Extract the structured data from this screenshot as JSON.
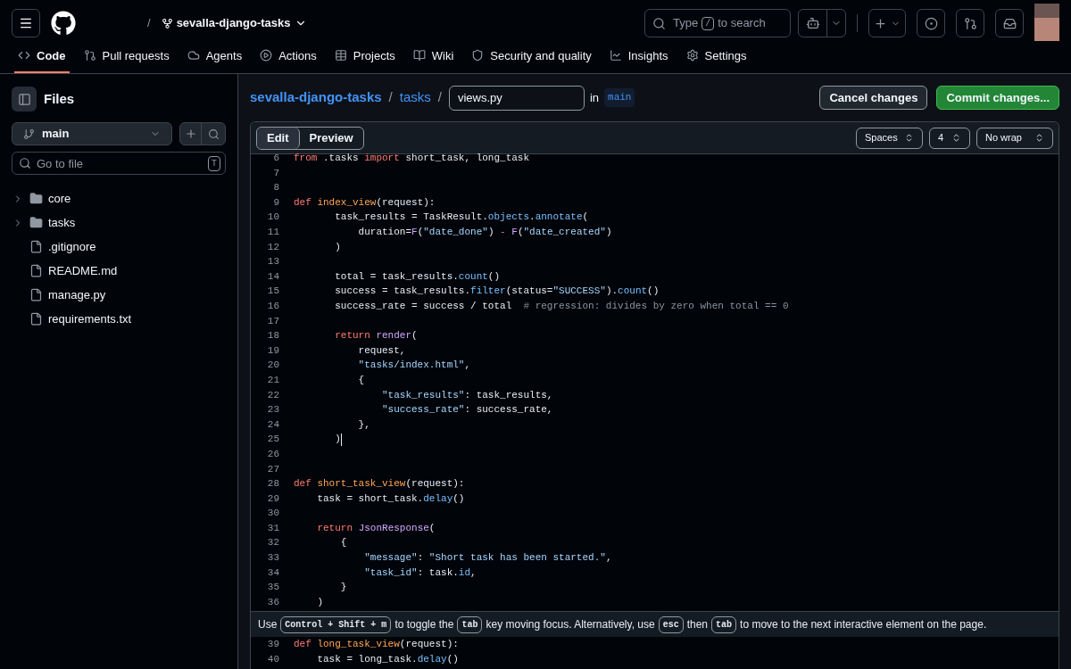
{
  "header": {
    "repo": "sevalla-django-tasks",
    "separator": "/",
    "search": {
      "placeholder_before": "Type",
      "key": "/",
      "placeholder_after": "to search"
    }
  },
  "nav": [
    {
      "label": "Code",
      "selected": true
    },
    {
      "label": "Pull requests",
      "selected": false
    },
    {
      "label": "Agents",
      "selected": false
    },
    {
      "label": "Actions",
      "selected": false
    },
    {
      "label": "Projects",
      "selected": false
    },
    {
      "label": "Wiki",
      "selected": false
    },
    {
      "label": "Security and quality",
      "selected": false
    },
    {
      "label": "Insights",
      "selected": false
    },
    {
      "label": "Settings",
      "selected": false
    }
  ],
  "sidebar": {
    "title": "Files",
    "branch": "main",
    "search": {
      "placeholder": "Go to file",
      "key": "T"
    },
    "items": [
      {
        "kind": "folder",
        "name": "core",
        "expanded": false
      },
      {
        "kind": "folder",
        "name": "tasks",
        "expanded": false
      },
      {
        "kind": "file",
        "name": ".gitignore"
      },
      {
        "kind": "file",
        "name": "README.md"
      },
      {
        "kind": "file",
        "name": "manage.py"
      },
      {
        "kind": "file",
        "name": "requirements.txt"
      }
    ]
  },
  "breadcrumb": {
    "repo": "sevalla-django-tasks",
    "folder": "tasks",
    "separator": "/",
    "filename": "views.py",
    "in_label": "in",
    "branch": "main"
  },
  "actions": [
    "Cancel changes",
    "Commit changes..."
  ],
  "editor": {
    "tabs": [
      {
        "label": "Edit",
        "selected": true
      },
      {
        "label": "Preview",
        "selected": false
      }
    ],
    "selects": [
      "Spaces",
      "4",
      "No wrap"
    ],
    "lines": [
      {
        "number": "6",
        "tokens": [
          {
            "kind": "keyword",
            "text": "from"
          },
          {
            "kind": "plain",
            "text": " .tasks "
          },
          {
            "kind": "keyword",
            "text": "import"
          },
          {
            "kind": "plain",
            "text": " short_task, long_task"
          }
        ]
      },
      {
        "number": "7"
      },
      {
        "number": "8"
      },
      {
        "number": "9",
        "tokens": [
          {
            "kind": "keyword",
            "text": "def "
          },
          {
            "kind": "function",
            "text": "index_view"
          },
          {
            "kind": "plain",
            "text": "(request):"
          }
        ]
      },
      {
        "number": "10",
        "tokens": [
          {
            "kind": "plain",
            "text": "       task_results = TaskResult."
          },
          {
            "kind": "method",
            "text": "objects"
          },
          {
            "kind": "plain",
            "text": "."
          },
          {
            "kind": "method",
            "text": "annotate"
          },
          {
            "kind": "plain",
            "text": "("
          }
        ]
      },
      {
        "number": "11",
        "tokens": [
          {
            "kind": "plain",
            "text": "           duration="
          },
          {
            "kind": "call",
            "text": "F"
          },
          {
            "kind": "plain",
            "text": "("
          },
          {
            "kind": "string",
            "text": "\"date_done\""
          },
          {
            "kind": "plain",
            "text": ") "
          },
          {
            "kind": "keyword",
            "text": "- "
          },
          {
            "kind": "call",
            "text": "F"
          },
          {
            "kind": "plain",
            "text": "("
          },
          {
            "kind": "string",
            "text": "\"date_created\""
          },
          {
            "kind": "plain",
            "text": ")"
          }
        ]
      },
      {
        "number": "12",
        "tokens": [
          {
            "kind": "plain",
            "text": "       )"
          }
        ]
      },
      {
        "number": "13"
      },
      {
        "number": "14",
        "tokens": [
          {
            "kind": "plain",
            "text": "       total = task_results."
          },
          {
            "kind": "method",
            "text": "count"
          },
          {
            "kind": "plain",
            "text": "()"
          }
        ]
      },
      {
        "number": "15",
        "tokens": [
          {
            "kind": "plain",
            "text": "       success = task_results."
          },
          {
            "kind": "method",
            "text": "filter"
          },
          {
            "kind": "plain",
            "text": "(status="
          },
          {
            "kind": "string",
            "text": "\"SUCCESS\""
          },
          {
            "kind": "plain",
            "text": ")."
          },
          {
            "kind": "method",
            "text": "count"
          },
          {
            "kind": "plain",
            "text": "()"
          }
        ]
      },
      {
        "number": "16",
        "tokens": [
          {
            "kind": "plain",
            "text": "       success_rate = success / total  "
          },
          {
            "kind": "comment",
            "text": "# regression: divides by zero when total == 0"
          }
        ]
      },
      {
        "number": "17"
      },
      {
        "number": "18",
        "tokens": [
          {
            "kind": "keyword",
            "text": "       return "
          },
          {
            "kind": "call",
            "text": "render"
          },
          {
            "kind": "plain",
            "text": "("
          }
        ]
      },
      {
        "number": "19",
        "tokens": [
          {
            "kind": "plain",
            "text": "           request,"
          }
        ]
      },
      {
        "number": "20",
        "tokens": [
          {
            "kind": "string",
            "text": "           \"tasks/index.html\""
          },
          {
            "kind": "plain",
            "text": ","
          }
        ]
      },
      {
        "number": "21",
        "tokens": [
          {
            "kind": "plain",
            "text": "           {"
          }
        ]
      },
      {
        "number": "22",
        "tokens": [
          {
            "kind": "string",
            "text": "               \"task_results\""
          },
          {
            "kind": "plain",
            "text": ": task_results,"
          }
        ]
      },
      {
        "number": "23",
        "tokens": [
          {
            "kind": "string",
            "text": "               \"success_rate\""
          },
          {
            "kind": "plain",
            "text": ": success_rate,"
          }
        ]
      },
      {
        "number": "24",
        "tokens": [
          {
            "kind": "plain",
            "text": "           },"
          }
        ]
      },
      {
        "number": "25",
        "cursor": true,
        "tokens": [
          {
            "kind": "plain",
            "text": "       )"
          }
        ]
      },
      {
        "number": "26"
      },
      {
        "number": "27"
      },
      {
        "number": "28",
        "tokens": [
          {
            "kind": "keyword",
            "text": "def "
          },
          {
            "kind": "function",
            "text": "short_task_view"
          },
          {
            "kind": "plain",
            "text": "(request):"
          }
        ]
      },
      {
        "number": "29",
        "tokens": [
          {
            "kind": "plain",
            "text": "    task = short_task."
          },
          {
            "kind": "method",
            "text": "delay"
          },
          {
            "kind": "plain",
            "text": "()"
          }
        ]
      },
      {
        "number": "30"
      },
      {
        "number": "31",
        "tokens": [
          {
            "kind": "keyword",
            "text": "    return "
          },
          {
            "kind": "call",
            "text": "JsonResponse"
          },
          {
            "kind": "plain",
            "text": "("
          }
        ]
      },
      {
        "number": "32",
        "tokens": [
          {
            "kind": "plain",
            "text": "        {"
          }
        ]
      },
      {
        "number": "33",
        "tokens": [
          {
            "kind": "string",
            "text": "            \"message\""
          },
          {
            "kind": "plain",
            "text": ": "
          },
          {
            "kind": "string",
            "text": "\"Short task has been started.\""
          },
          {
            "kind": "plain",
            "text": ","
          }
        ]
      },
      {
        "number": "34",
        "tokens": [
          {
            "kind": "string",
            "text": "            \"task_id\""
          },
          {
            "kind": "plain",
            "text": ": task."
          },
          {
            "kind": "method",
            "text": "id"
          },
          {
            "kind": "plain",
            "text": ","
          }
        ]
      },
      {
        "number": "35",
        "tokens": [
          {
            "kind": "plain",
            "text": "        }"
          }
        ]
      },
      {
        "number": "36",
        "tokens": [
          {
            "kind": "plain",
            "text": "    )"
          }
        ]
      }
    ],
    "lines_after": [
      {
        "number": "39",
        "tokens": [
          {
            "kind": "keyword",
            "text": "def "
          },
          {
            "kind": "function",
            "text": "long_task_view"
          },
          {
            "kind": "plain",
            "text": "(request):"
          }
        ]
      },
      {
        "number": "40",
        "tokens": [
          {
            "kind": "plain",
            "text": "    task = long_task."
          },
          {
            "kind": "method",
            "text": "delay"
          },
          {
            "kind": "plain",
            "text": "()"
          }
        ]
      }
    ],
    "hint": [
      {
        "kind": "text",
        "text": "Use"
      },
      {
        "kind": "key",
        "text": "Control + Shift + m"
      },
      {
        "kind": "text",
        "text": "to toggle the"
      },
      {
        "kind": "key",
        "text": "tab"
      },
      {
        "kind": "text",
        "text": "key moving focus. Alternatively, use"
      },
      {
        "kind": "key",
        "text": "esc"
      },
      {
        "kind": "text",
        "text": "then"
      },
      {
        "kind": "key",
        "text": "tab"
      },
      {
        "kind": "text",
        "text": "to move to the next interactive element on the page."
      }
    ]
  }
}
